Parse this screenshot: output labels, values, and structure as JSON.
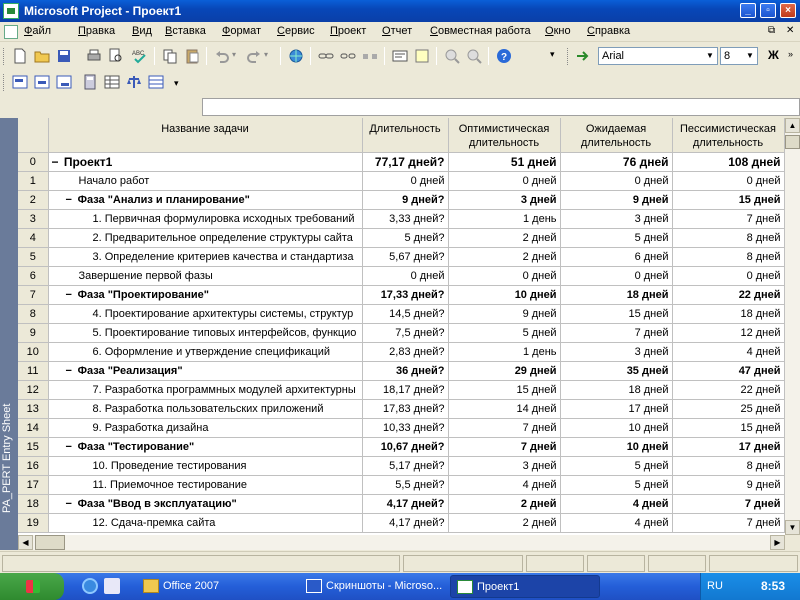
{
  "window": {
    "title": "Microsoft Project - Проект1"
  },
  "menu": [
    "Файл",
    "Правка",
    "Вид",
    "Вставка",
    "Формат",
    "Сервис",
    "Проект",
    "Отчет",
    "Совместная работа",
    "Окно",
    "Справка"
  ],
  "toolbar": {
    "font_name": "Arial",
    "font_size": "8",
    "bold_label": "Ж"
  },
  "view_bar": {
    "label": "PA_PERT Entry Sheet"
  },
  "table": {
    "headers": {
      "name": "Название задачи",
      "duration": "Длительность",
      "optimistic": "Оптимистическая длительность",
      "expected": "Ожидаемая длительность",
      "pessimistic": "Пессимистическая длительность"
    },
    "rows": [
      {
        "id": "0",
        "name": "Проект1",
        "duration": "77,17 дней?",
        "optimistic": "51 дней",
        "expected": "76 дней",
        "pessimistic": "108 дней",
        "level": 0,
        "summary": true
      },
      {
        "id": "1",
        "name": "Начало работ",
        "duration": "0 дней",
        "optimistic": "0 дней",
        "expected": "0 дней",
        "pessimistic": "0 дней",
        "level": 1,
        "summary": false
      },
      {
        "id": "2",
        "name": "Фаза \"Анализ и планирование\"",
        "duration": "9 дней?",
        "optimistic": "3 дней",
        "expected": "9 дней",
        "pessimistic": "15 дней",
        "level": 1,
        "summary": true
      },
      {
        "id": "3",
        "name": "1. Первичная формулировка исходных требований",
        "duration": "3,33 дней?",
        "optimistic": "1 день",
        "expected": "3 дней",
        "pessimistic": "7 дней",
        "level": 2,
        "summary": false
      },
      {
        "id": "4",
        "name": "2. Предварительное определение структуры сайта",
        "duration": "5 дней?",
        "optimistic": "2 дней",
        "expected": "5 дней",
        "pessimistic": "8 дней",
        "level": 2,
        "summary": false
      },
      {
        "id": "5",
        "name": "3. Определение критериев качества и стандартиза",
        "duration": "5,67 дней?",
        "optimistic": "2 дней",
        "expected": "6 дней",
        "pessimistic": "8 дней",
        "level": 2,
        "summary": false
      },
      {
        "id": "6",
        "name": "Завершение первой фазы",
        "duration": "0 дней",
        "optimistic": "0 дней",
        "expected": "0 дней",
        "pessimistic": "0 дней",
        "level": 1,
        "summary": false
      },
      {
        "id": "7",
        "name": "Фаза \"Проектирование\"",
        "duration": "17,33 дней?",
        "optimistic": "10 дней",
        "expected": "18 дней",
        "pessimistic": "22 дней",
        "level": 1,
        "summary": true
      },
      {
        "id": "8",
        "name": "4. Проектирование архитектуры системы, структур",
        "duration": "14,5 дней?",
        "optimistic": "9 дней",
        "expected": "15 дней",
        "pessimistic": "18 дней",
        "level": 2,
        "summary": false
      },
      {
        "id": "9",
        "name": "5. Проектирование типовых интерфейсов, функцио",
        "duration": "7,5 дней?",
        "optimistic": "5 дней",
        "expected": "7 дней",
        "pessimistic": "12 дней",
        "level": 2,
        "summary": false
      },
      {
        "id": "10",
        "name": "6. Оформление и утверждение спецификаций",
        "duration": "2,83 дней?",
        "optimistic": "1 день",
        "expected": "3 дней",
        "pessimistic": "4 дней",
        "level": 2,
        "summary": false
      },
      {
        "id": "11",
        "name": "Фаза \"Реализация\"",
        "duration": "36 дней?",
        "optimistic": "29 дней",
        "expected": "35 дней",
        "pessimistic": "47 дней",
        "level": 1,
        "summary": true
      },
      {
        "id": "12",
        "name": "7. Разработка программных модулей архитектурны",
        "duration": "18,17 дней?",
        "optimistic": "15 дней",
        "expected": "18 дней",
        "pessimistic": "22 дней",
        "level": 2,
        "summary": false
      },
      {
        "id": "13",
        "name": "8. Разработка пользовательских приложений",
        "duration": "17,83 дней?",
        "optimistic": "14 дней",
        "expected": "17 дней",
        "pessimistic": "25 дней",
        "level": 2,
        "summary": false
      },
      {
        "id": "14",
        "name": "9. Разработка дизайна",
        "duration": "10,33 дней?",
        "optimistic": "7 дней",
        "expected": "10 дней",
        "pessimistic": "15 дней",
        "level": 2,
        "summary": false
      },
      {
        "id": "15",
        "name": "Фаза \"Тестирование\"",
        "duration": "10,67 дней?",
        "optimistic": "7 дней",
        "expected": "10 дней",
        "pessimistic": "17 дней",
        "level": 1,
        "summary": true
      },
      {
        "id": "16",
        "name": "10. Проведение тестирования",
        "duration": "5,17 дней?",
        "optimistic": "3 дней",
        "expected": "5 дней",
        "pessimistic": "8 дней",
        "level": 2,
        "summary": false
      },
      {
        "id": "17",
        "name": "11. Приемочное тестирование",
        "duration": "5,5 дней?",
        "optimistic": "4 дней",
        "expected": "5 дней",
        "pessimistic": "9 дней",
        "level": 2,
        "summary": false
      },
      {
        "id": "18",
        "name": "Фаза \"Ввод в эксплуатацию\"",
        "duration": "4,17 дней?",
        "optimistic": "2 дней",
        "expected": "4 дней",
        "pessimistic": "7 дней",
        "level": 1,
        "summary": true
      },
      {
        "id": "19",
        "name": "12. Сдача-премка сайта",
        "duration": "4,17 дней?",
        "optimistic": "2 дней",
        "expected": "4 дней",
        "pessimistic": "7 дней",
        "level": 2,
        "summary": false
      }
    ]
  },
  "taskbar": {
    "tasks": [
      {
        "label": "Office 2007",
        "icon": "folder-icon"
      },
      {
        "label": "Скриншоты - Microso...",
        "icon": "word-icon"
      },
      {
        "label": "Проект1",
        "icon": "project-icon"
      }
    ],
    "language": "RU",
    "clock": "8:53"
  },
  "colors": {
    "title_bar": "#0a4fc8",
    "view_bar": "#6a7b9a",
    "taskbar": "#245ed8",
    "tray": "#1278d0"
  }
}
